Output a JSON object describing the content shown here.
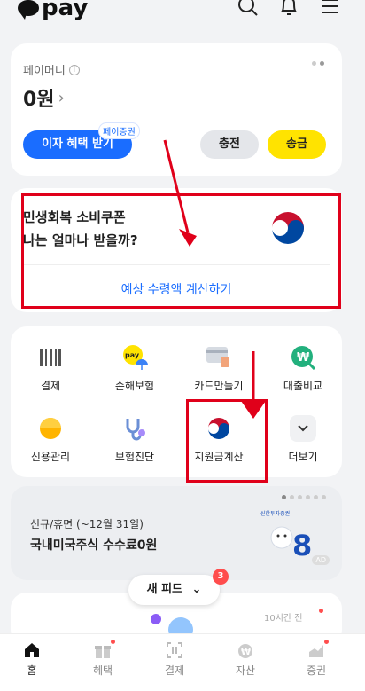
{
  "header": {
    "logo_text": "pay",
    "icons": [
      "search-icon",
      "bell-icon",
      "menu-icon"
    ]
  },
  "pay_money": {
    "label": "페이머니",
    "amount": "0원",
    "interest_button": "이자 혜택 받기",
    "voucher_badge": "페이증권",
    "charge_button": "충전",
    "send_button": "송금"
  },
  "coupon_card": {
    "title_line1": "민생회복 소비쿠폰",
    "title_line2": "나는 얼마나 받을까?",
    "link": "예상 수령액 계산하기"
  },
  "services": [
    {
      "label": "결제",
      "icon": "barcode-icon"
    },
    {
      "label": "손해보험",
      "icon": "pay-umbrella-icon"
    },
    {
      "label": "카드만들기",
      "icon": "card-icon"
    },
    {
      "label": "대출비교",
      "icon": "won-search-icon"
    },
    {
      "label": "신용관리",
      "icon": "credit-gauge-icon"
    },
    {
      "label": "보험진단",
      "icon": "stethoscope-icon"
    },
    {
      "label": "지원금계산",
      "icon": "taegeuk-icon"
    },
    {
      "label": "더보기",
      "icon": "chevron-down-icon"
    }
  ],
  "promo": {
    "subtitle": "신규/휴면 (~12월 31일)",
    "title": "국내미국주식 수수료0원",
    "brand": "신한투자증권",
    "ad_tag": "AD"
  },
  "feed": {
    "button": "새 피드",
    "badge": "3",
    "time": "10시간 전"
  },
  "bottom_nav": [
    {
      "label": "홈",
      "icon": "home-icon",
      "active": true
    },
    {
      "label": "혜택",
      "icon": "gift-icon",
      "dot": true
    },
    {
      "label": "결제",
      "icon": "scan-icon"
    },
    {
      "label": "자산",
      "icon": "won-bag-icon"
    },
    {
      "label": "증권",
      "icon": "stock-chart-icon",
      "dot": true
    }
  ],
  "colors": {
    "accent": "#1a6dff",
    "yellow": "#ffe300",
    "annotation": "#e0001a",
    "badge": "#ff4d4d"
  }
}
